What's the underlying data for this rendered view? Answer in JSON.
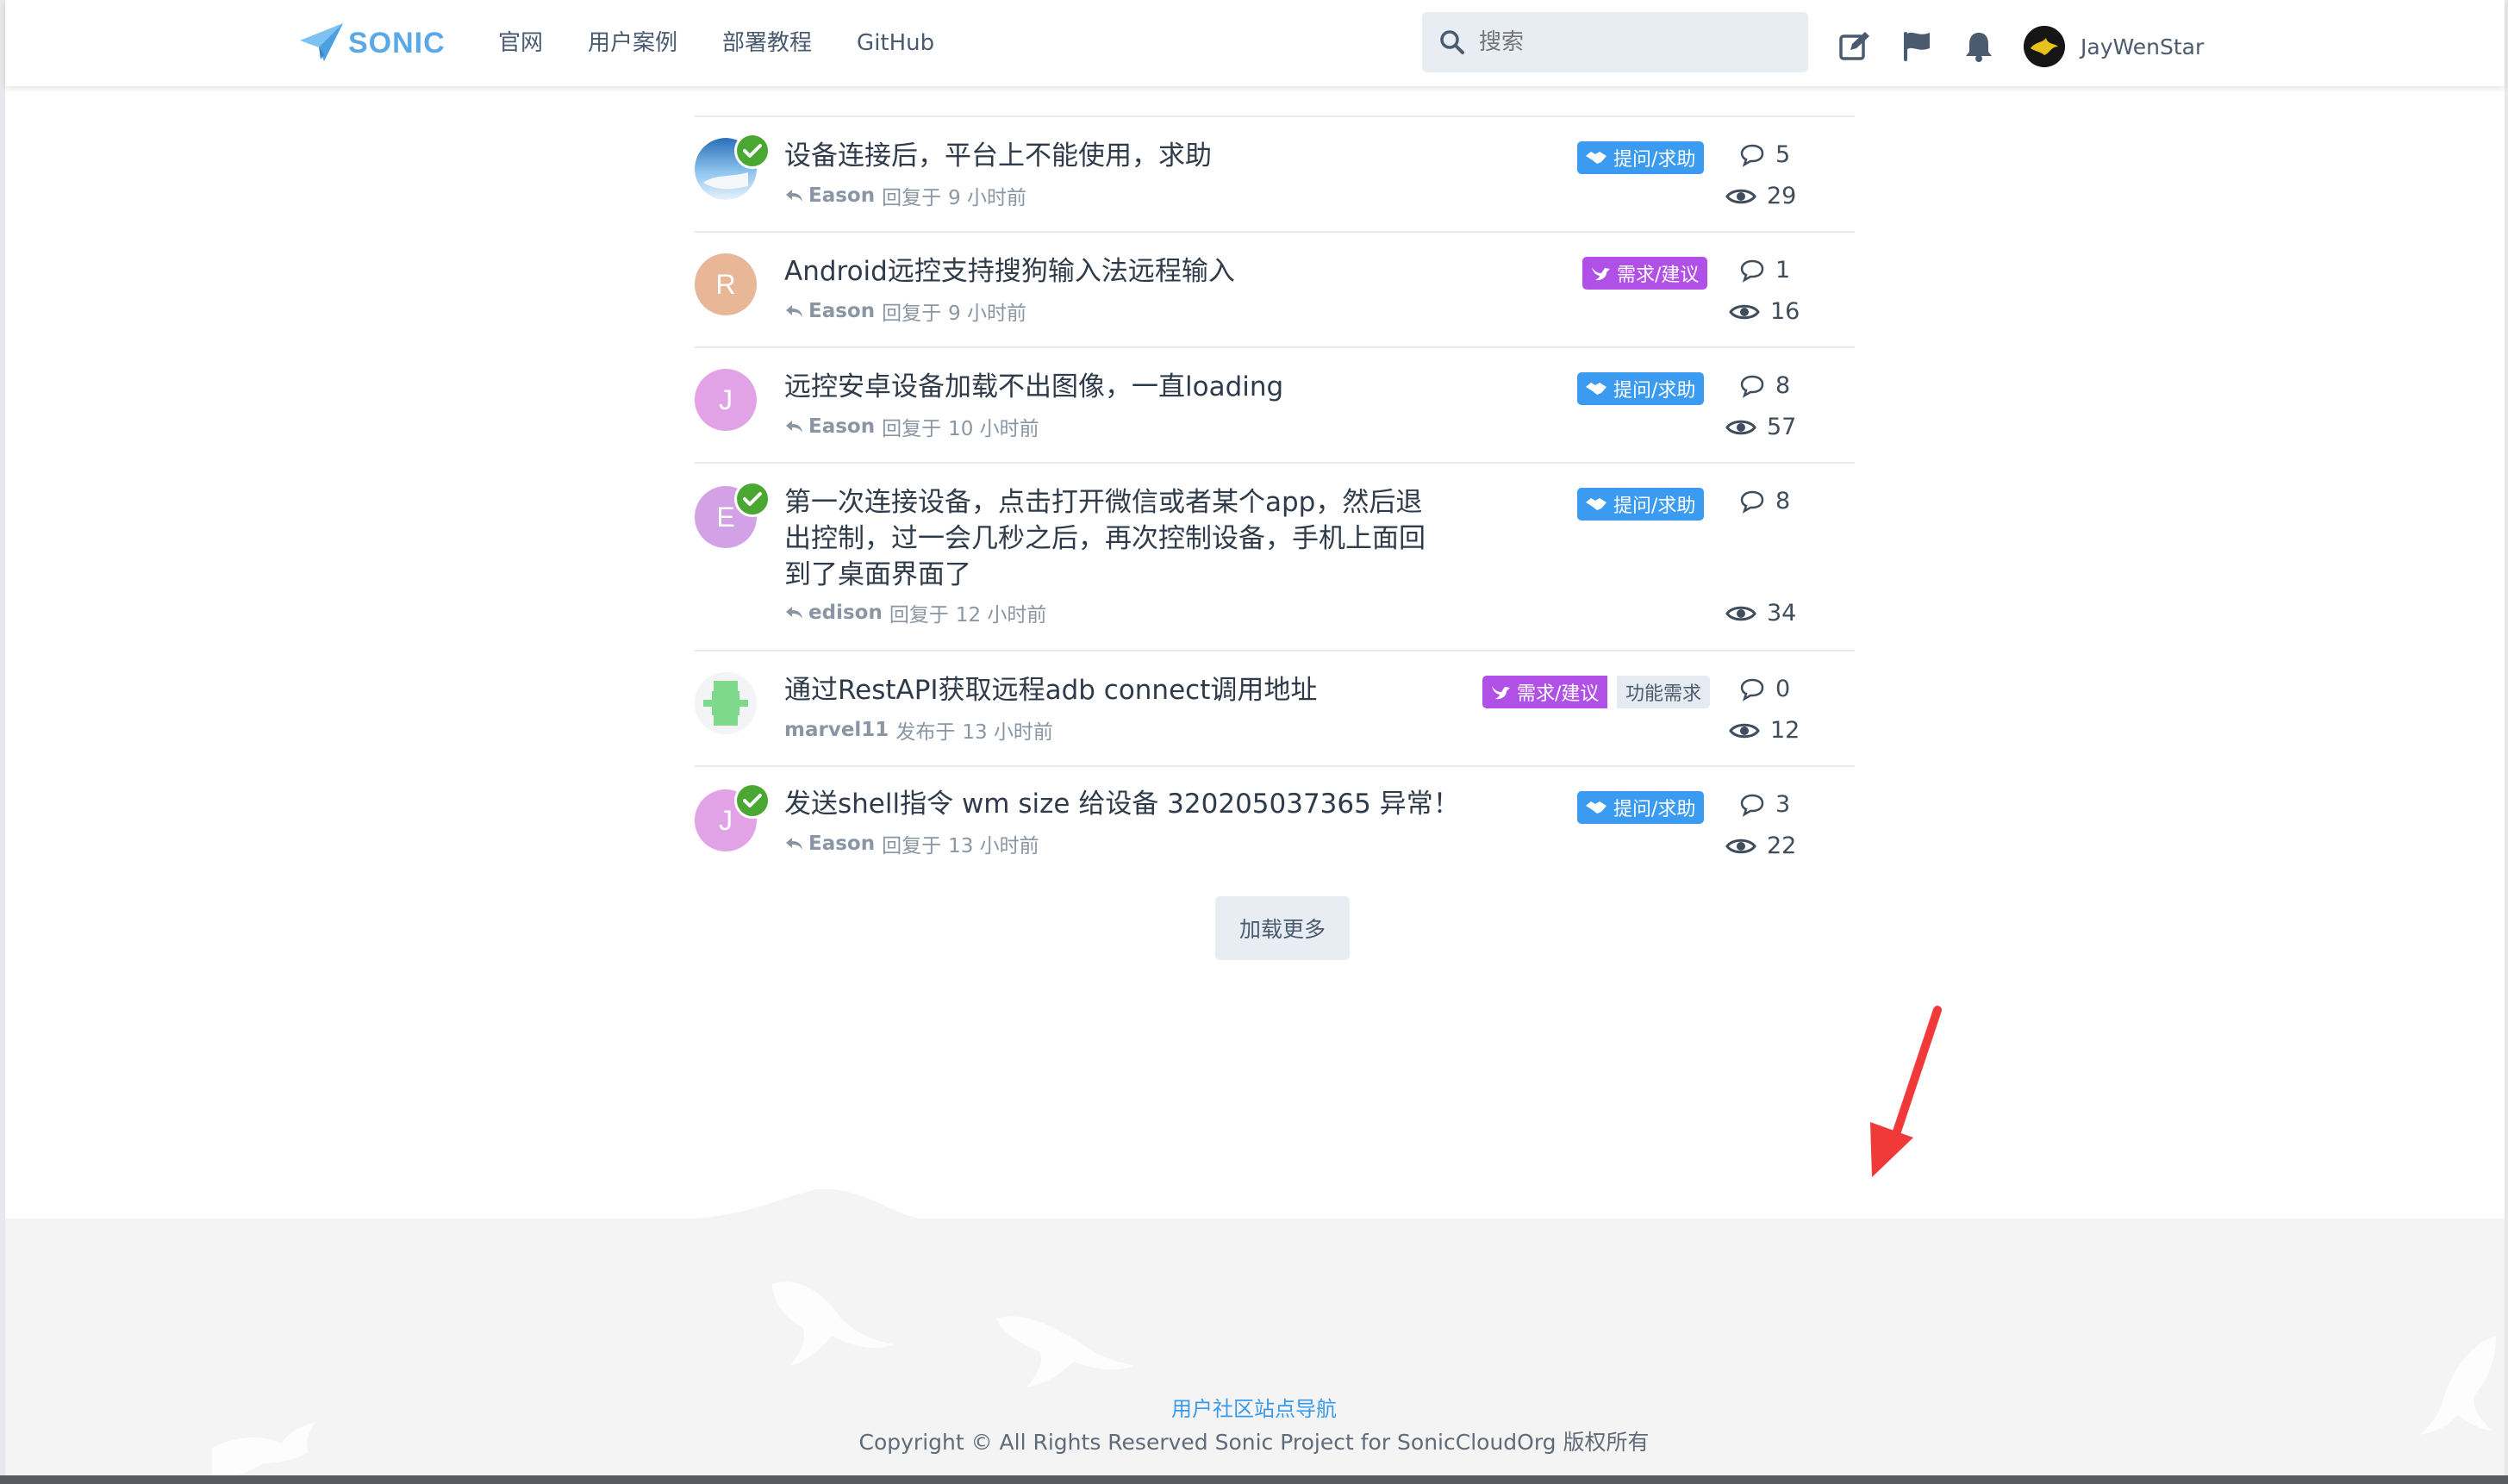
{
  "header": {
    "logo_text": "SONIC",
    "nav": [
      "官网",
      "用户案例",
      "部署教程",
      "GitHub"
    ],
    "search_placeholder": "搜索",
    "username": "JayWenStar"
  },
  "topics": [
    {
      "title_lines": [
        "设备连接后，平台上不能使用，求助"
      ],
      "user": "Eason",
      "action": "回复于",
      "time": "9 小时前",
      "tags": [
        {
          "label": "提问/求助",
          "kind": "blue"
        }
      ],
      "replies": "5",
      "views": "29",
      "avatar": {
        "type": "photo"
      },
      "solved": true
    },
    {
      "title_lines": [
        "Android远控支持搜狗输入法远程输入"
      ],
      "user": "Eason",
      "action": "回复于",
      "time": "9 小时前",
      "tags": [
        {
          "label": "需求/建议",
          "kind": "purple"
        }
      ],
      "replies": "1",
      "views": "16",
      "avatar": {
        "type": "letter",
        "letter": "R",
        "color": "#e8b797"
      },
      "solved": false
    },
    {
      "title_lines": [
        "远控安卓设备加载不出图像，一直loading"
      ],
      "user": "Eason",
      "action": "回复于",
      "time": "10 小时前",
      "tags": [
        {
          "label": "提问/求助",
          "kind": "blue"
        }
      ],
      "replies": "8",
      "views": "57",
      "avatar": {
        "type": "letter",
        "letter": "J",
        "color": "#e2a3e6"
      },
      "solved": false
    },
    {
      "title_lines": [
        "第一次连接设备，点击打开微信或者某个app，然后退",
        "出控制，过一会几秒之后，再次控制设备，手机上面回",
        "到了桌面界面了"
      ],
      "user": "edison",
      "action": "回复于",
      "time": "12 小时前",
      "tags": [
        {
          "label": "提问/求助",
          "kind": "blue"
        }
      ],
      "replies": "8",
      "views": "34",
      "avatar": {
        "type": "letter",
        "letter": "E",
        "color": "#d3a1e6"
      },
      "solved": true
    },
    {
      "title_lines": [
        "通过RestAPI获取远程adb connect调用地址"
      ],
      "user": "marvel11",
      "action": "发布于",
      "time": "13 小时前",
      "tags": [
        {
          "label": "需求/建议",
          "kind": "purple"
        },
        {
          "label": "功能需求",
          "kind": "gray"
        }
      ],
      "replies": "0",
      "views": "12",
      "avatar": {
        "type": "identicon"
      },
      "solved": false
    },
    {
      "title_lines": [
        "发送shell指令 wm size 给设备 320205037365 异常！"
      ],
      "user": "Eason",
      "action": "回复于",
      "time": "13 小时前",
      "tags": [
        {
          "label": "提问/求助",
          "kind": "blue"
        }
      ],
      "replies": "3",
      "views": "22",
      "avatar": {
        "type": "letter",
        "letter": "J",
        "color": "#e2a3e6"
      },
      "solved": true
    }
  ],
  "load_more_label": "加载更多",
  "footer": {
    "nav_link": "用户社区站点导航",
    "copyright": "Copyright © All Rights Reserved Sonic Project for SonicCloudOrg 版权所有"
  },
  "colors": {
    "tag_blue": "#3b9bf0",
    "tag_purple": "#b050e6",
    "solved_green": "#4aa832",
    "annotation_arrow": "#f03a3a"
  }
}
